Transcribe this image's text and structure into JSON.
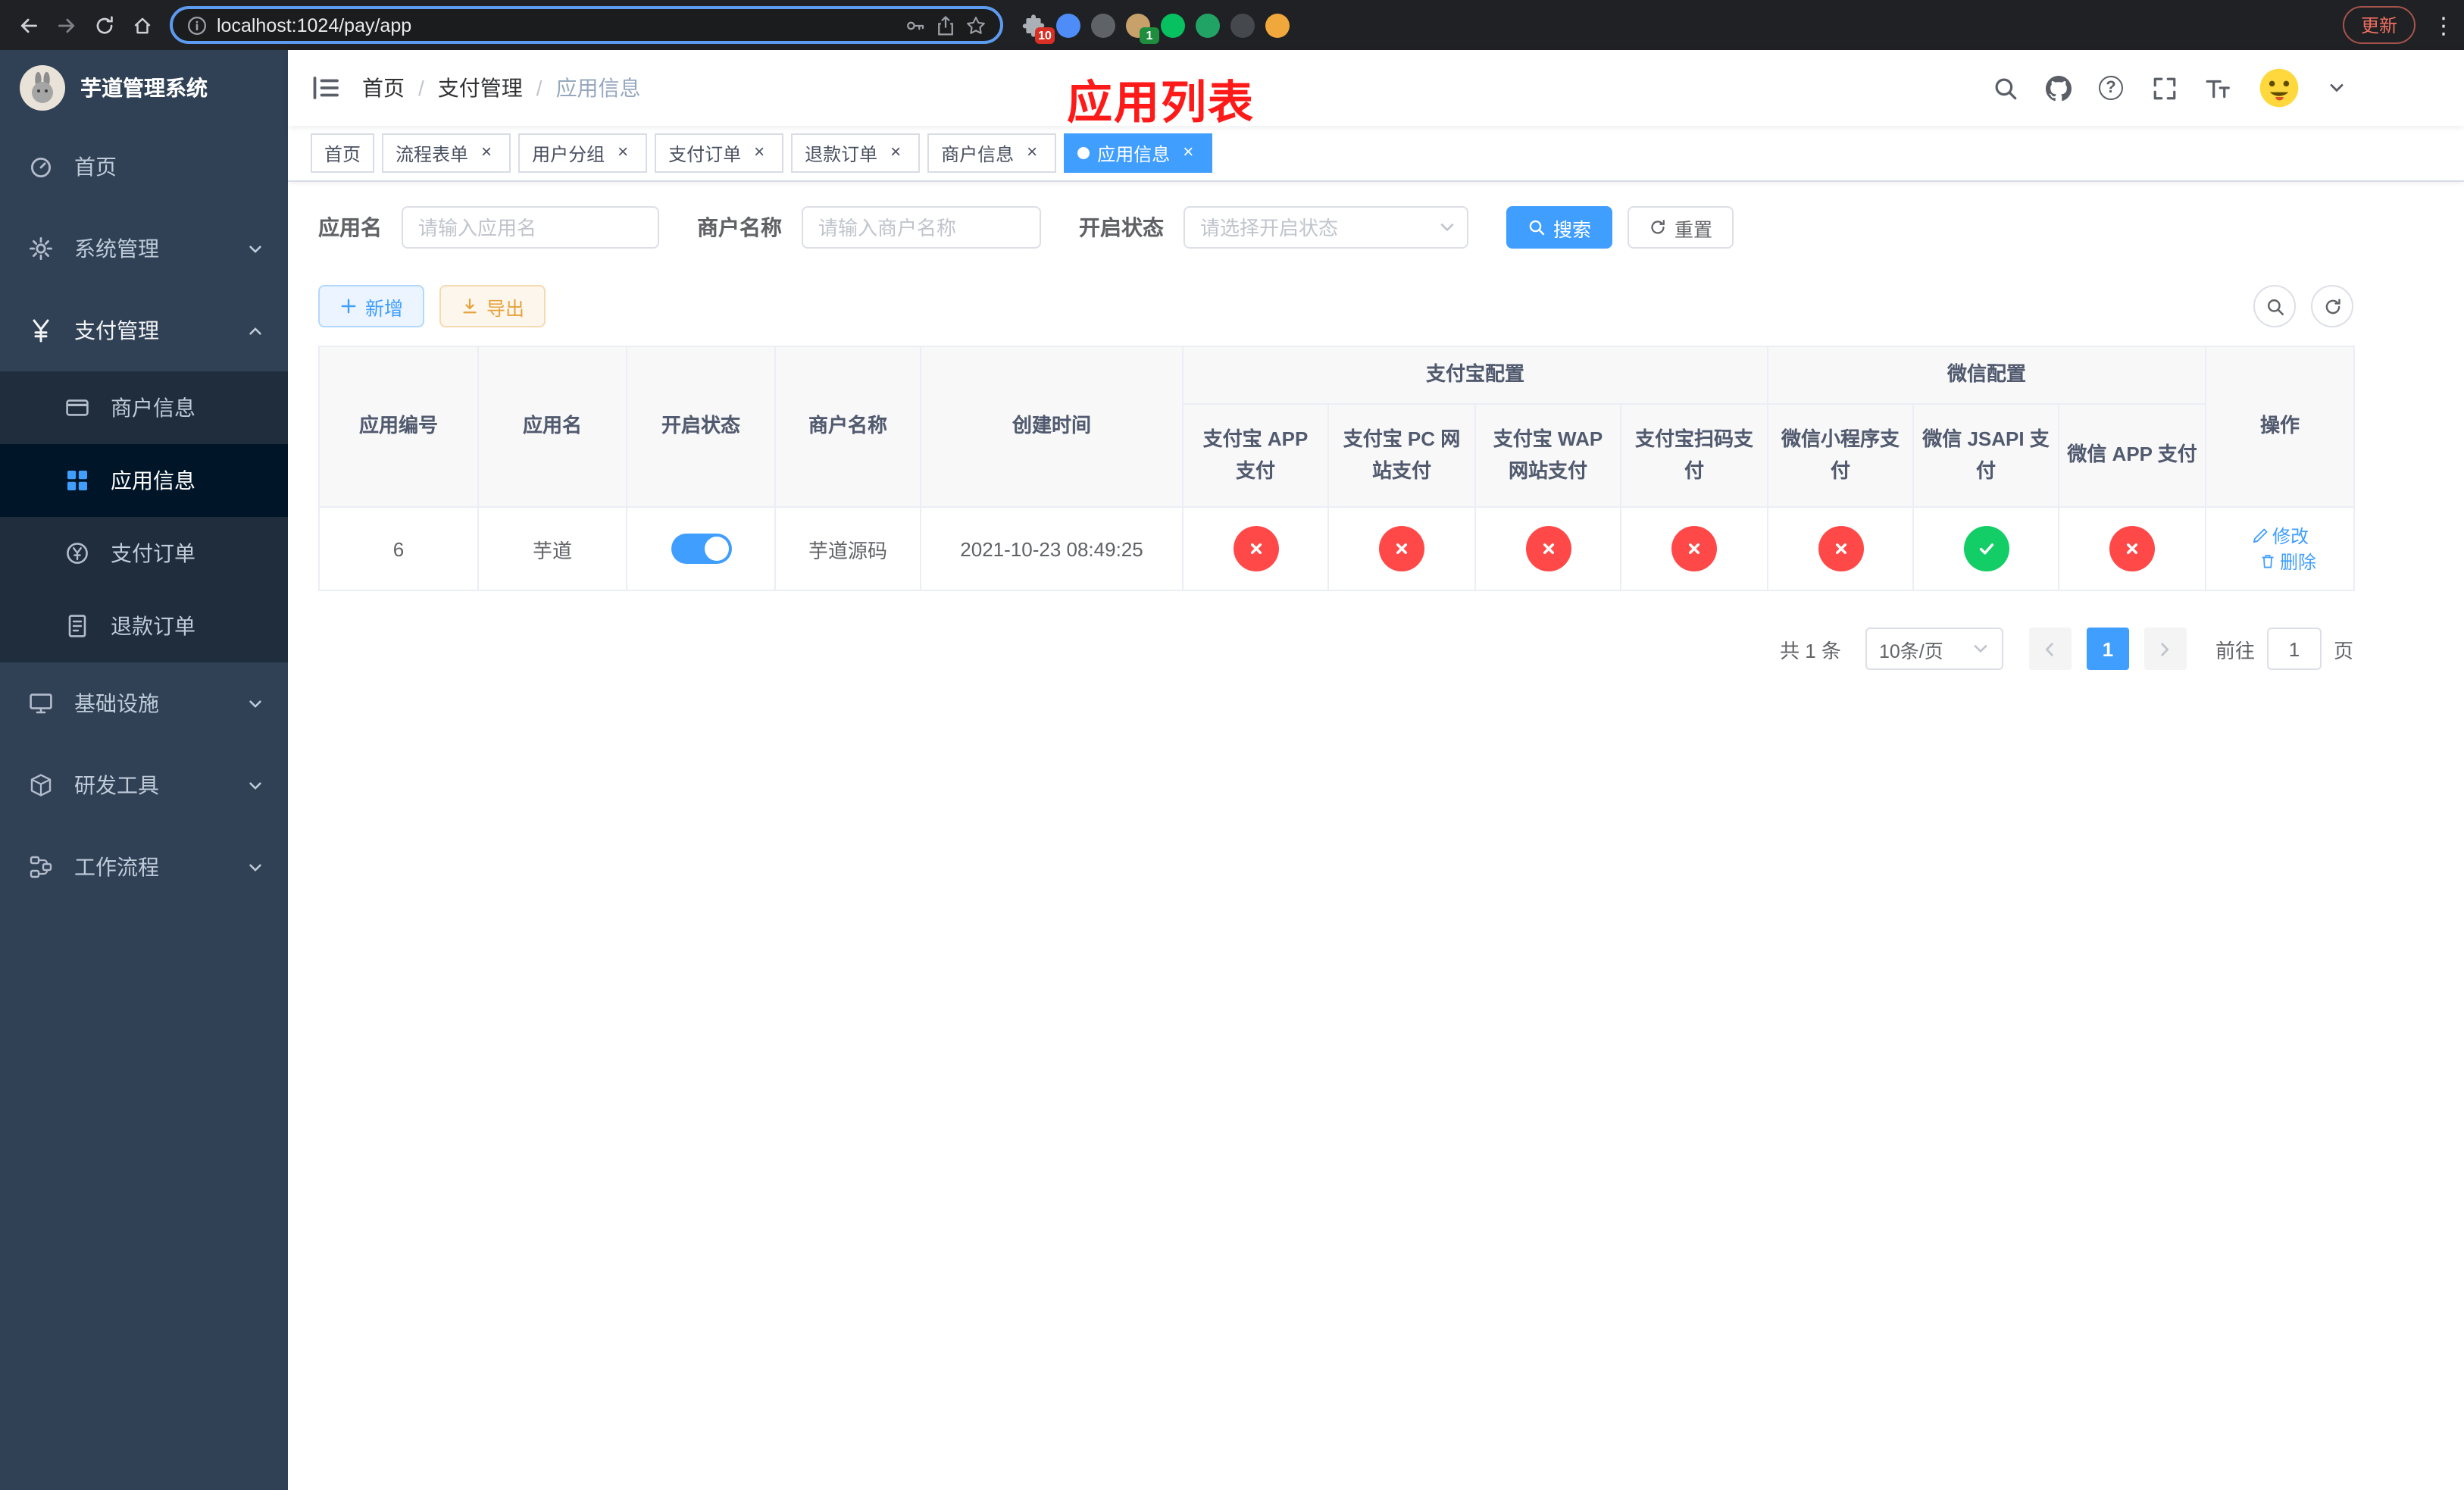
{
  "browser": {
    "url": "localhost:1024/pay/app",
    "update_label": "更新",
    "extensions": [
      {
        "key": "puzzle",
        "color": "#aab0b6",
        "badge": "10",
        "badge_color": "#d93025"
      },
      {
        "key": "blue-drop",
        "color": "#4e8cf7"
      },
      {
        "key": "gray-globe",
        "color": "#5f6368"
      },
      {
        "key": "tan-avatar",
        "color": "#c8a06a",
        "badge": "1",
        "badge_color": "#1e8e3e"
      },
      {
        "key": "wechat-green",
        "color": "#07c160"
      },
      {
        "key": "green-square",
        "color": "#21a366"
      },
      {
        "key": "dark-circle",
        "color": "#45494e"
      },
      {
        "key": "orange-face",
        "color": "#f0a73c"
      }
    ]
  },
  "sidebar": {
    "title": "芋道管理系统",
    "items": [
      {
        "key": "home",
        "label": "首页",
        "icon": "dashboard"
      },
      {
        "key": "system",
        "label": "系统管理",
        "icon": "gear",
        "expandable": true
      },
      {
        "key": "payment",
        "label": "支付管理",
        "icon": "yen",
        "expandable": true,
        "expanded": true,
        "children": [
          {
            "key": "merchant-info",
            "label": "商户信息",
            "icon": "card"
          },
          {
            "key": "app-info",
            "label": "应用信息",
            "icon": "grid",
            "active": true
          },
          {
            "key": "pay-order",
            "label": "支付订单",
            "icon": "coin"
          },
          {
            "key": "refund-order",
            "label": "退款订单",
            "icon": "receipt"
          }
        ]
      },
      {
        "key": "infrastructure",
        "label": "基础设施",
        "icon": "monitor",
        "expandable": true
      },
      {
        "key": "dev-tools",
        "label": "研发工具",
        "icon": "box",
        "expandable": true
      },
      {
        "key": "workflow",
        "label": "工作流程",
        "icon": "flow",
        "expandable": true
      }
    ]
  },
  "header": {
    "breadcrumb": [
      "首页",
      "支付管理",
      "应用信息"
    ],
    "overlay_title": "应用列表",
    "icons": [
      "search",
      "github",
      "help",
      "fullscreen",
      "font-size",
      "avatar"
    ]
  },
  "tabs": [
    {
      "key": "home",
      "label": "首页",
      "closable": false
    },
    {
      "key": "flow-form",
      "label": "流程表单",
      "closable": true
    },
    {
      "key": "user-group",
      "label": "用户分组",
      "closable": true
    },
    {
      "key": "pay-order",
      "label": "支付订单",
      "closable": true
    },
    {
      "key": "refund-order",
      "label": "退款订单",
      "closable": true
    },
    {
      "key": "merchant-info",
      "label": "商户信息",
      "closable": true
    },
    {
      "key": "app-info",
      "label": "应用信息",
      "closable": true,
      "active": true
    }
  ],
  "filters": {
    "app_name_label": "应用名",
    "app_name_placeholder": "请输入应用名",
    "merchant_label": "商户名称",
    "merchant_placeholder": "请输入商户名称",
    "status_label": "开启状态",
    "status_placeholder": "请选择开启状态",
    "search_label": "搜索",
    "reset_label": "重置"
  },
  "toolbar": {
    "add_label": "新增",
    "export_label": "导出"
  },
  "table": {
    "group_alipay": "支付宝配置",
    "group_wechat": "微信配置",
    "columns": [
      "应用编号",
      "应用名",
      "开启状态",
      "商户名称",
      "创建时间",
      "支付宝 APP 支付",
      "支付宝 PC 网站支付",
      "支付宝 WAP 网站支付",
      "支付宝扫码支付",
      "微信小程序支付",
      "微信 JSAPI 支付",
      "微信 APP 支付",
      "操作"
    ],
    "row": {
      "id": "6",
      "name": "芋道",
      "status_on": true,
      "merchant": "芋道源码",
      "created": "2021-10-23 08:49:25",
      "configs": [
        "no",
        "no",
        "no",
        "no",
        "no",
        "yes",
        "no"
      ],
      "edit_label": "修改",
      "delete_label": "删除"
    }
  },
  "pagination": {
    "total_text": "共 1 条",
    "page_size": "10条/页",
    "current_page": "1",
    "goto_label": "前往",
    "goto_value": "1",
    "goto_suffix": "页"
  },
  "colors": {
    "accent_blue": "#409EFF",
    "sidebar_bg": "#304156",
    "submenu_bg": "#1f2d3d",
    "danger_red": "#ff4949",
    "success_green": "#13ce66",
    "annotation_red": "#ff1a1a",
    "warning_orange": "#e6a23c"
  }
}
